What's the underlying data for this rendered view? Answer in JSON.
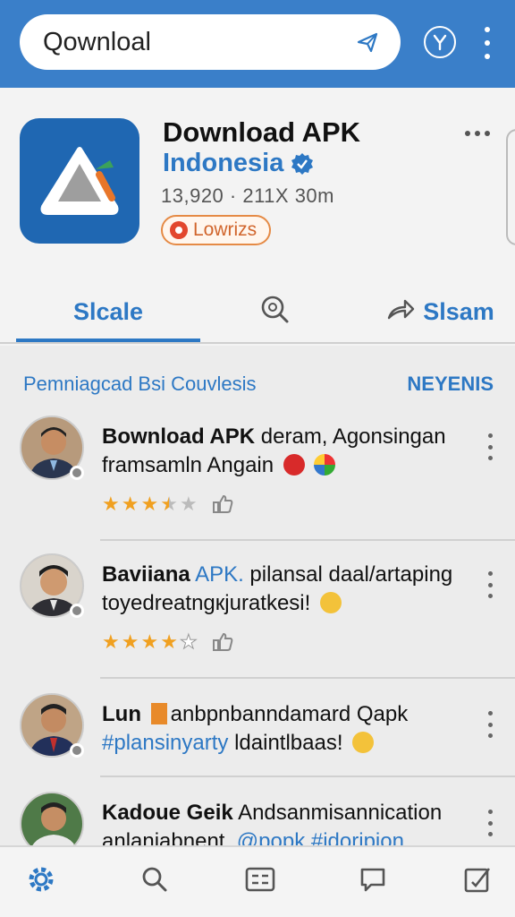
{
  "search": {
    "value": "Qownloal"
  },
  "app": {
    "title": "Download APK",
    "subtitle": "Indonesia",
    "meta": "13,920 · 211X 30m",
    "badge": "Lowrizs"
  },
  "tabs": [
    {
      "label": "Slcale"
    },
    {
      "label": ""
    },
    {
      "label": "Slsam"
    }
  ],
  "section": {
    "title": "Pemniagcad Bsi Couvlesis",
    "link": "NEYENIS"
  },
  "reviews": [
    {
      "name": "Bownload APK",
      "line1_rest": " deram, Agonsingan",
      "line2": "framsamln Angain",
      "rating": 3.5
    },
    {
      "name": "Baviiana",
      "line1_hl": " APK.",
      "line1_rest": " pilansal daal/artaping",
      "line2": "toyedreatngкjuratkesi!",
      "rating": 4
    },
    {
      "name": "Lun",
      "line1_rest": "anbpnbanndamard Qapk",
      "line2_hl": "#plansinyarty",
      "line2": " ldaintlbaas!",
      "rating": 0
    },
    {
      "name": "Kadoue Geik",
      "line1_rest": " Andsanmisannication",
      "line2": "anlaniabnent, ",
      "line2_hl": "@popk #idoripion",
      "rating": 0
    }
  ],
  "colors": {
    "primary": "#3a7fc9",
    "accent": "#2d78c4",
    "star": "#f0a020",
    "badge": "#e58a45"
  },
  "icons": [
    "send-icon",
    "filter-icon",
    "more-icon",
    "verified-icon",
    "search-icon",
    "share-icon",
    "like-icon",
    "settings-icon",
    "list-icon",
    "chat-icon",
    "edit-icon"
  ]
}
